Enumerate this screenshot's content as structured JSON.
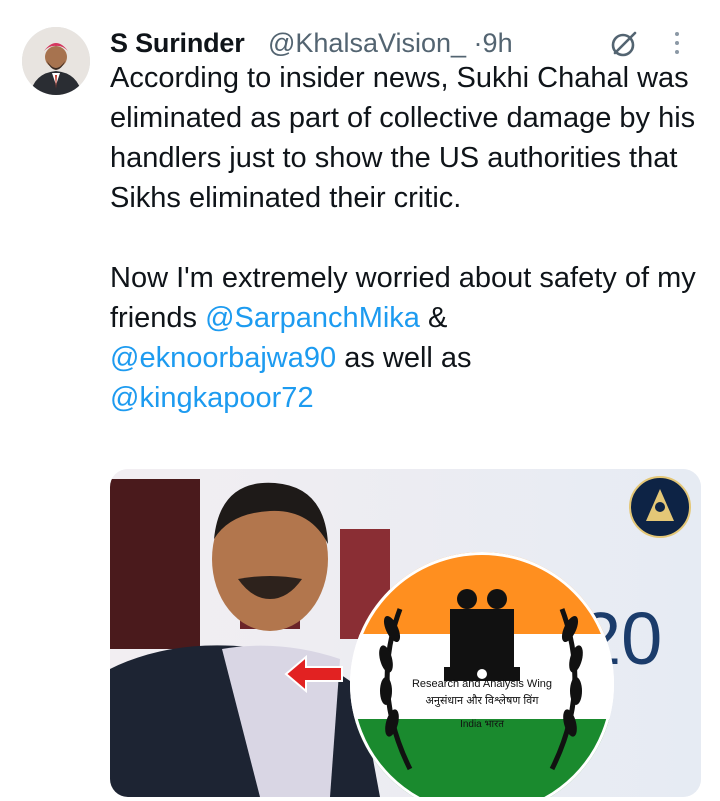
{
  "author": {
    "display_name": "S Surinder",
    "handle": "@KhalsaVision_",
    "separator": "·",
    "time": "9h"
  },
  "tweet": {
    "line1": "According to insider news, Sukhi Chahal was eliminated as part of collective damage by his handlers just to show the US authorities that Sikhs eliminated their critic.",
    "line2_prefix": "Now I'm extremely worried about safety of my friends ",
    "mention1": "@SarpanchMika",
    "amp": " & ",
    "mention2": "@eknoorbajwa90",
    "mid": " as well as ",
    "mention3": "@kingkapoor72"
  },
  "icons": [
    "grok-icon",
    "more-icon"
  ],
  "colors": {
    "link": "#1d9bf0",
    "muted": "#536471",
    "text": "#0f1419"
  },
  "media": {
    "emblem_text1": "Research and Analysis Wing",
    "emblem_text2": "अनुसंधान और विश्लेषण विंग",
    "emblem_text3": "India भारत",
    "background_text": "20"
  }
}
